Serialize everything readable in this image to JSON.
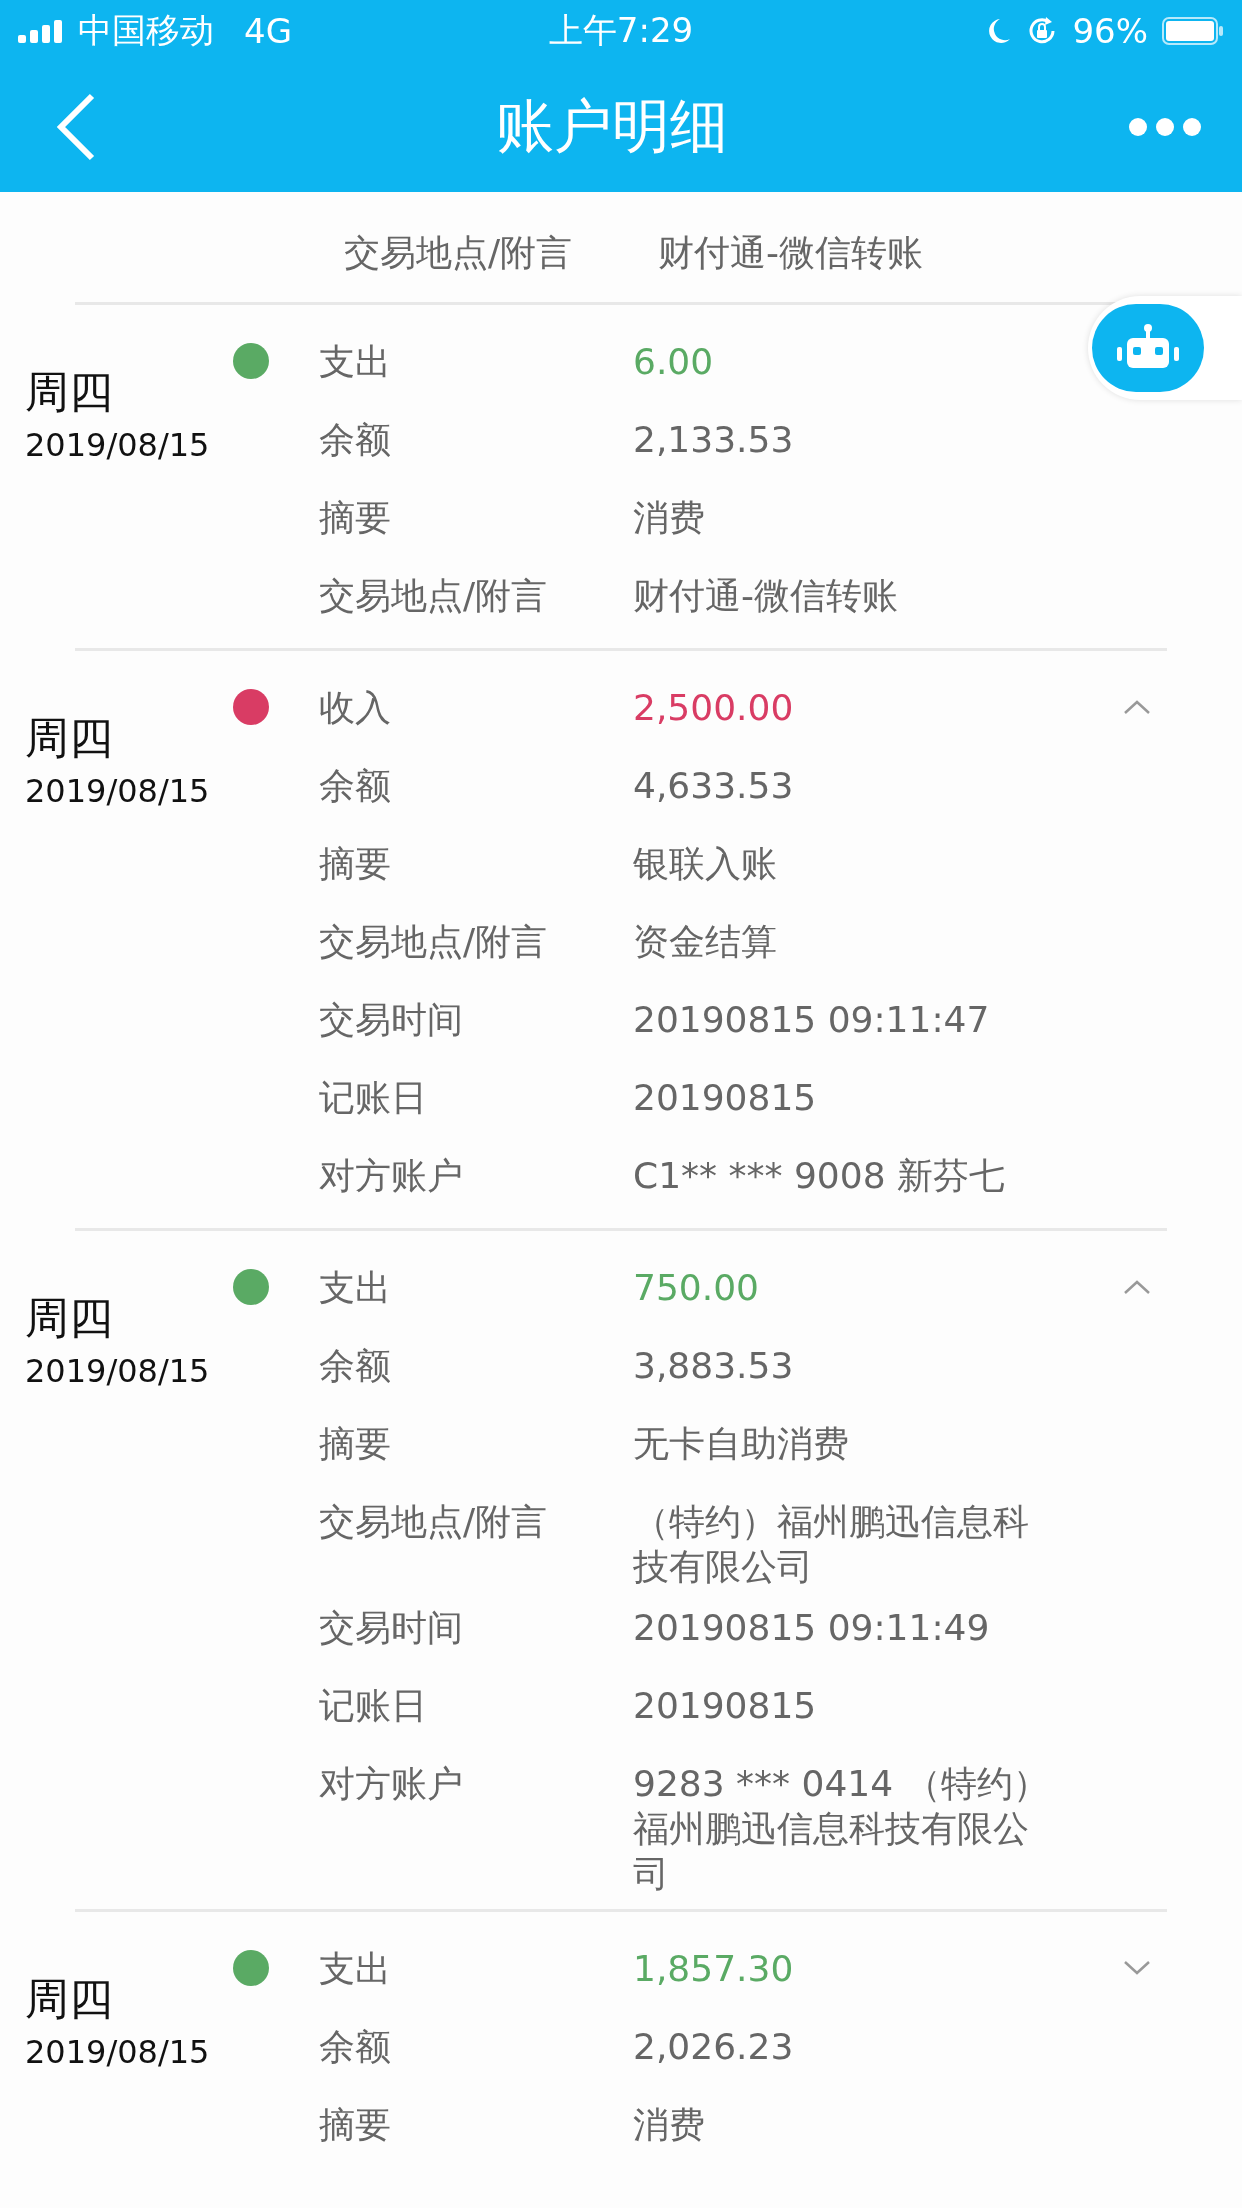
{
  "status_bar": {
    "carrier": "中国移动",
    "network": "4G",
    "time": "上午7:29",
    "battery": "96%"
  },
  "nav": {
    "title": "账户明细"
  },
  "entries": [
    {
      "rows": [
        {
          "label": "交易地点/附言",
          "value": "财付通-微信转账"
        }
      ]
    },
    {
      "day": "周四",
      "date": "2019/08/15",
      "color": "#5aaa64",
      "rows": [
        {
          "label": "支出",
          "value": "6.00"
        },
        {
          "label": "余额",
          "value": "2,133.53"
        },
        {
          "label": "摘要",
          "value": "消费"
        },
        {
          "label": "交易地点/附言",
          "value": "财付通-微信转账"
        }
      ]
    },
    {
      "day": "周四",
      "date": "2019/08/15",
      "color": "#d93c64",
      "expanded": true,
      "rows": [
        {
          "label": "收入",
          "value": "2,500.00"
        },
        {
          "label": "余额",
          "value": "4,633.53"
        },
        {
          "label": "摘要",
          "value": "银联入账"
        },
        {
          "label": "交易地点/附言",
          "value": "资金结算"
        },
        {
          "label": "交易时间",
          "value": "20190815 09:11:47"
        },
        {
          "label": "记账日",
          "value": "20190815"
        },
        {
          "label": "对方账户",
          "value": "C1** *** 9008 新芬七"
        }
      ]
    },
    {
      "day": "周四",
      "date": "2019/08/15",
      "color": "#5aaa64",
      "expanded": true,
      "rows": [
        {
          "label": "支出",
          "value": "750.00"
        },
        {
          "label": "余额",
          "value": "3,883.53"
        },
        {
          "label": "摘要",
          "value": "无卡自助消费"
        },
        {
          "label": "交易地点/附言",
          "value": "（特约）福州鹏迅信息科技有限公司"
        },
        {
          "label": "交易时间",
          "value": "20190815 09:11:49"
        },
        {
          "label": "记账日",
          "value": "20190815"
        },
        {
          "label": "对方账户",
          "value": "9283 *** 0414 （特约）福州鹏迅信息科技有限公司"
        }
      ]
    },
    {
      "day": "周四",
      "date": "2019/08/15",
      "color": "#5aaa64",
      "expanded": false,
      "rows": [
        {
          "label": "支出",
          "value": "1,857.30"
        },
        {
          "label": "余额",
          "value": "2,026.23"
        },
        {
          "label": "摘要",
          "value": "消费"
        }
      ]
    }
  ]
}
